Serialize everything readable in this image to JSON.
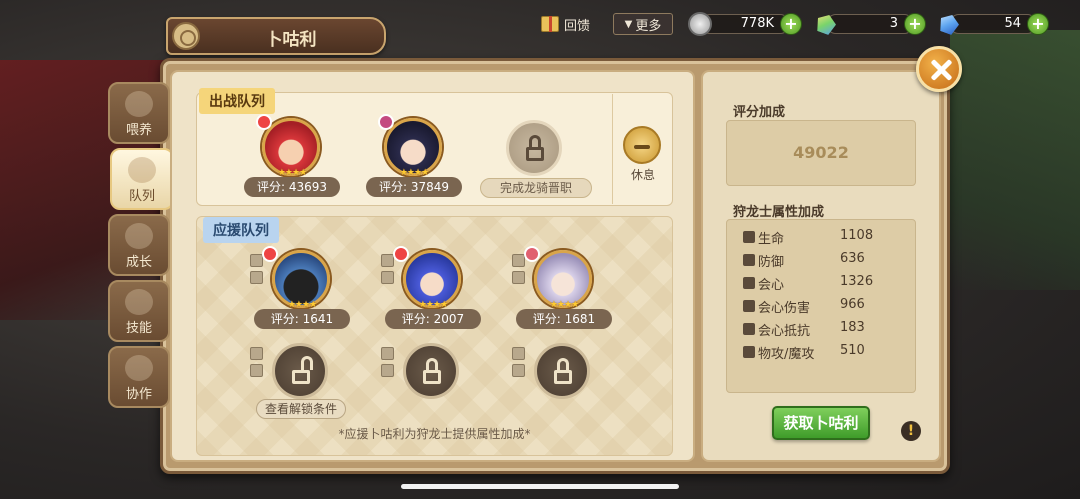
{
  "header": {
    "title": "卜咕利",
    "gift_label": "回馈",
    "more_label": "更多",
    "more_arrow": "▼"
  },
  "resources": {
    "coins": "778K",
    "green_gem": "3",
    "blue_gem": "54",
    "plus": "+"
  },
  "tabs": [
    {
      "label": "喂养",
      "icon": "sprout-icon"
    },
    {
      "label": "队列",
      "icon": "rabbit-icon",
      "active": true
    },
    {
      "label": "成长",
      "icon": "paw-icon"
    },
    {
      "label": "技能",
      "icon": "wings-icon"
    },
    {
      "label": "协作",
      "icon": "paw-group-icon"
    }
  ],
  "battle": {
    "label": "出战队列",
    "slots": [
      {
        "score": "评分: 43693",
        "stars": "★★★★"
      },
      {
        "score": "评分: 37849",
        "stars": "★★★★"
      },
      {
        "locked_text": "完成龙骑晋职"
      }
    ],
    "rest_label": "休息"
  },
  "support": {
    "label": "应援队列",
    "slots": [
      {
        "score": "评分: 1641",
        "stars": "★★★★"
      },
      {
        "score": "评分: 2007",
        "stars": "★★★★"
      },
      {
        "score": "评分: 1681",
        "stars": "★★★★"
      }
    ],
    "unlock_label": "查看解锁条件",
    "note": "*应援卜咕利为狩龙士提供属性加成*"
  },
  "right": {
    "score_title": "评分加成",
    "score_value": "49022",
    "attr_title": "狩龙士属性加成",
    "attrs": [
      {
        "name": "生命",
        "value": "1108"
      },
      {
        "name": "防御",
        "value": "636"
      },
      {
        "name": "会心",
        "value": "1326"
      },
      {
        "name": "会心伤害",
        "value": "966"
      },
      {
        "name": "会心抵抗",
        "value": "183"
      },
      {
        "name": "物攻/魔攻",
        "value": "510"
      }
    ],
    "get_button": "获取卜咕利",
    "info": "!"
  }
}
